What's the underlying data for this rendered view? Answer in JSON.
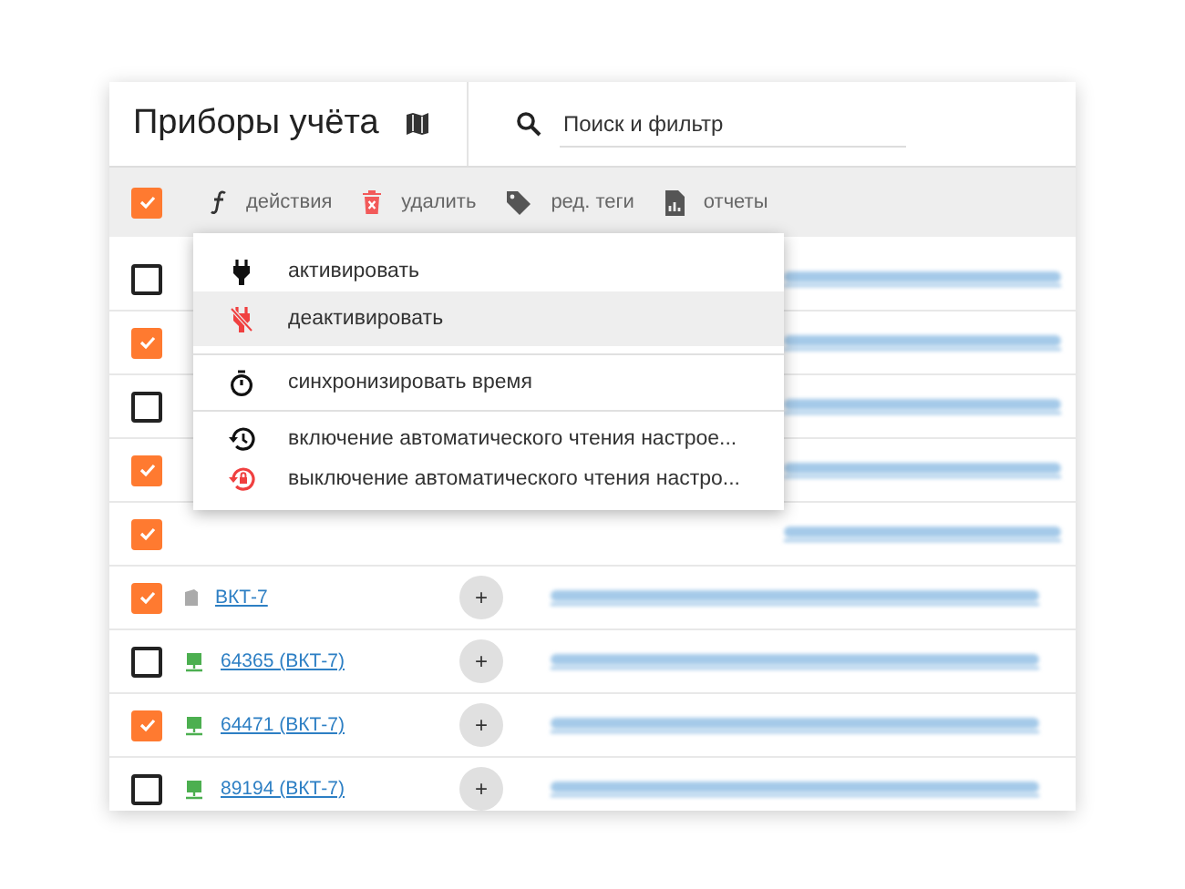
{
  "header": {
    "title": "Приборы учёта",
    "search": {
      "placeholder": "Поиск и фильтр"
    }
  },
  "toolbar": {
    "select_all": {
      "checked": true
    },
    "actions": [
      {
        "kind": "function",
        "label": "действия"
      },
      {
        "kind": "delete",
        "label": "удалить"
      },
      {
        "kind": "tag",
        "label": "ред. теги"
      },
      {
        "kind": "report",
        "label": "отчеты"
      }
    ]
  },
  "menu": {
    "groups": [
      [
        {
          "kind": "plug",
          "label": "активировать",
          "selected": false
        },
        {
          "kind": "plug-off",
          "label": "деактивировать",
          "selected": true
        }
      ],
      [
        {
          "kind": "timer",
          "label": "синхронизировать время",
          "selected": false
        }
      ],
      [
        {
          "kind": "history",
          "label": "включение автоматического чтения настрое...",
          "selected": false
        },
        {
          "kind": "lock-reset",
          "label": "выключение автоматического чтения настро...",
          "selected": false
        }
      ]
    ]
  },
  "rows": [
    {
      "checked": false
    },
    {
      "checked": true
    },
    {
      "checked": false
    },
    {
      "checked": true
    },
    {
      "checked": true
    },
    {
      "checked": true,
      "device": {
        "kind": "archived",
        "label": "ВКТ-7"
      },
      "action": "+"
    },
    {
      "checked": false,
      "device": {
        "kind": "online",
        "label": "64365 (ВКТ-7)"
      },
      "action": "+"
    },
    {
      "checked": true,
      "device": {
        "kind": "online",
        "label": "64471 (ВКТ-7)"
      },
      "action": "+"
    },
    {
      "checked": false,
      "device": {
        "kind": "online",
        "label": "89194 (ВКТ-7)"
      },
      "action": "+"
    }
  ]
}
